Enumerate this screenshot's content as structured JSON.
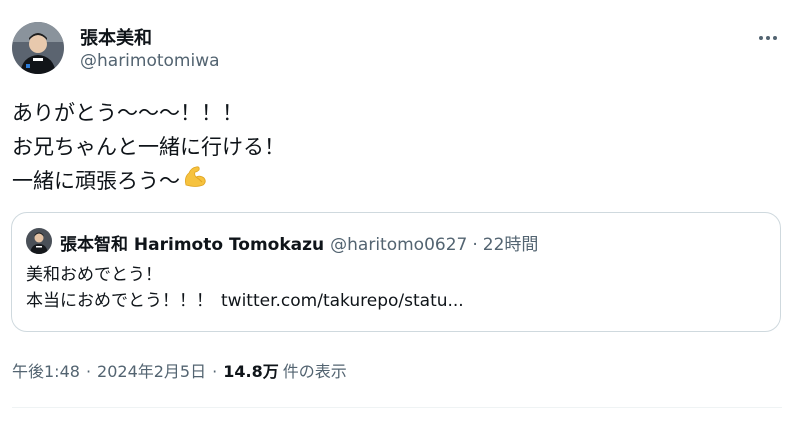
{
  "author": {
    "display_name": "張本美和",
    "handle": "@harimotomiwa"
  },
  "tweet": {
    "lines": [
      "ありがとう〜〜〜！！！",
      "お兄ちゃんと一緒に行ける！",
      "一緒に頑張ろう〜"
    ],
    "emoji": "💪"
  },
  "quote": {
    "display_name": "張本智和 Harimoto Tomokazu",
    "handle": "@haritomo0627",
    "separator": "·",
    "time": "22時間",
    "lines": [
      "美和おめでとう！",
      "本当におめでとう！！！"
    ],
    "link_text": "twitter.com/takurepo/statu..."
  },
  "meta": {
    "time": "午後1:48",
    "separator": "·",
    "date": "2024年2月5日",
    "views_count": "14.8万",
    "views_label": "件の表示"
  },
  "colors": {
    "text": "#0f1419",
    "secondary": "#536471",
    "border": "#cfd9de"
  },
  "icons": {
    "more": "more-horizontal-icon",
    "emoji": "flexed-biceps-emoji"
  }
}
